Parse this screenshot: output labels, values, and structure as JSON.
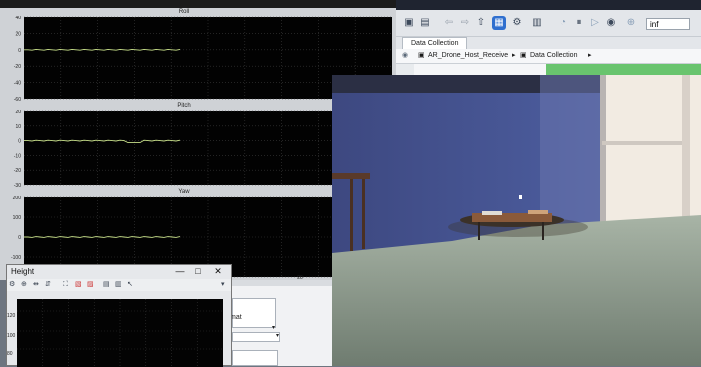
{
  "scope": {
    "plots": [
      {
        "title": "Roll",
        "yticks": [
          "40",
          "20",
          "0",
          "-20",
          "-40",
          "-60"
        ],
        "ylim": [
          -60,
          40
        ],
        "trace": {
          "x_end": 0.43,
          "level": 0,
          "color": "#c8e08a"
        }
      },
      {
        "title": "Pitch",
        "yticks": [
          "20",
          "10",
          "0",
          "-10",
          "-20",
          "-30"
        ],
        "ylim": [
          -30,
          20
        ],
        "trace": {
          "x_end": 0.43,
          "level": 0,
          "color": "#c8e08a"
        }
      },
      {
        "title": "Yaw",
        "yticks": [
          "200",
          "100",
          "0",
          "-100",
          "-200"
        ],
        "ylim": [
          -200,
          200
        ],
        "trace": {
          "x_end": 0.43,
          "level": 0,
          "color": "#c8e08a"
        }
      }
    ],
    "xtick_visible": "20"
  },
  "model_window": {
    "tab_label": "Data Collection",
    "breadcrumb": {
      "root": "AR_Drone_Host_Receive",
      "child": "Data Collection"
    },
    "zoom_value": "inf"
  },
  "prop_panel": {
    "label": "mat"
  },
  "height_window": {
    "title": "Height",
    "controls": {
      "minimize": "—",
      "maximize": "□",
      "close": "✕"
    },
    "yticks": [
      "120",
      "100",
      "80"
    ]
  },
  "colors": {
    "plot_bg": "#020202",
    "grid": "#3a3a3a",
    "trace": "#c8e08a",
    "wall": "#3e4a86",
    "floor": "#8e9a8a",
    "window_light": "#f2ebe2",
    "green_block": "#69c46e"
  }
}
